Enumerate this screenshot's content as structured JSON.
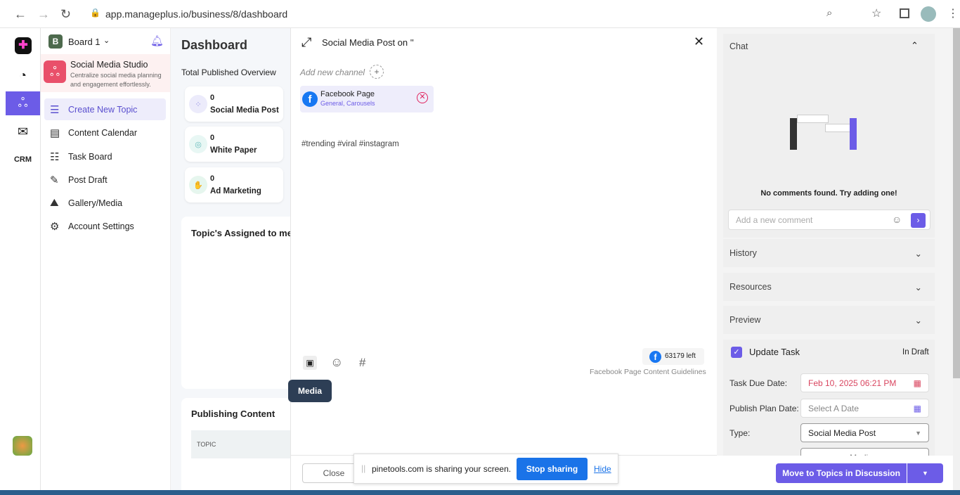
{
  "browser": {
    "url": "app.manageplus.io/business/8/dashboard"
  },
  "rail": {
    "items": [
      "dashboard",
      "social",
      "campaigns",
      "CRM"
    ]
  },
  "sidebar": {
    "board": "Board 1",
    "board_initial": "B",
    "app_title": "Social Media Studio",
    "app_desc": "Centralize social media planning and engagement effortlessly.",
    "items": [
      {
        "label": "Create New Topic",
        "icon": "list-add-icon"
      },
      {
        "label": "Content Calendar",
        "icon": "calendar-icon"
      },
      {
        "label": "Task Board",
        "icon": "checklist-icon"
      },
      {
        "label": "Post Draft",
        "icon": "edit-icon"
      },
      {
        "label": "Gallery/Media",
        "icon": "gallery-icon"
      },
      {
        "label": "Account Settings",
        "icon": "users-gear-icon"
      }
    ]
  },
  "dashboard": {
    "title": "Dashboard",
    "overview": "Total Published Overview",
    "cards": [
      {
        "count": "0",
        "label": "Social Media Post"
      },
      {
        "count": "0",
        "label": "White Paper"
      },
      {
        "count": "0",
        "label": "Ad Marketing"
      }
    ],
    "assigned_title": "Topic's Assigned to me",
    "publishing_title": "Publishing Content",
    "table_header": "TOPIC"
  },
  "modal": {
    "title": "Social Media Post on ''",
    "add_channel": "Add new channel",
    "channel": {
      "name": "Facebook Page",
      "sub": "General, Carousels"
    },
    "content": "#trending #viral #instagram",
    "chars_left": "63179 left",
    "guidelines": "Facebook Page Content Guidelines",
    "tooltip": "Media",
    "close": "Close"
  },
  "share_bar": {
    "text": "pinetools.com is sharing your screen.",
    "stop": "Stop sharing",
    "hide": "Hide"
  },
  "right": {
    "chat": "Chat",
    "empty": "No comments found. Try adding one!",
    "comment_placeholder": "Add a new comment",
    "history": "History",
    "resources": "Resources",
    "preview": "Preview",
    "update_task": "Update Task",
    "status": "In Draft",
    "due_label": "Task Due Date:",
    "due_value": "Feb 10, 2025 06:21 PM",
    "plan_label": "Publish Plan Date:",
    "plan_placeholder": "Select A Date",
    "type_label": "Type:",
    "type_value": "Social Media Post",
    "priority_value": "Medium",
    "move_button": "Move to Topics in Discussion"
  },
  "colors": {
    "accent": "#6c5ce7",
    "fb": "#1877f2",
    "danger": "#e0245e",
    "share": "#1a73e8"
  }
}
